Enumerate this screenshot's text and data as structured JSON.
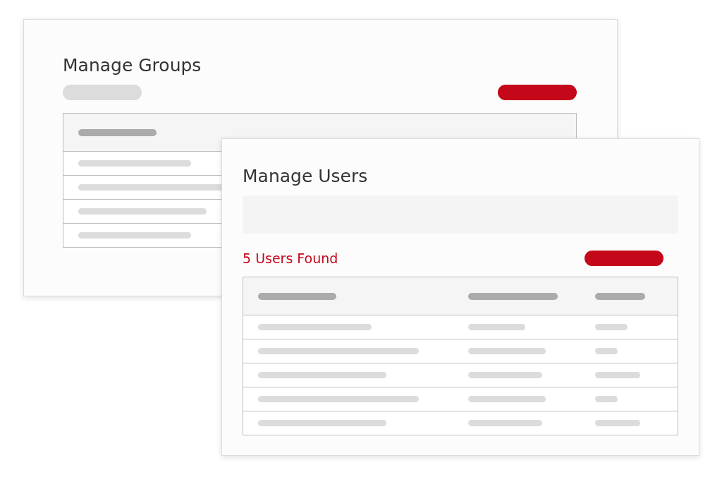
{
  "groups_window": {
    "title": "Manage Groups"
  },
  "users_window": {
    "title": "Manage Users",
    "result_count": "5 Users Found"
  }
}
